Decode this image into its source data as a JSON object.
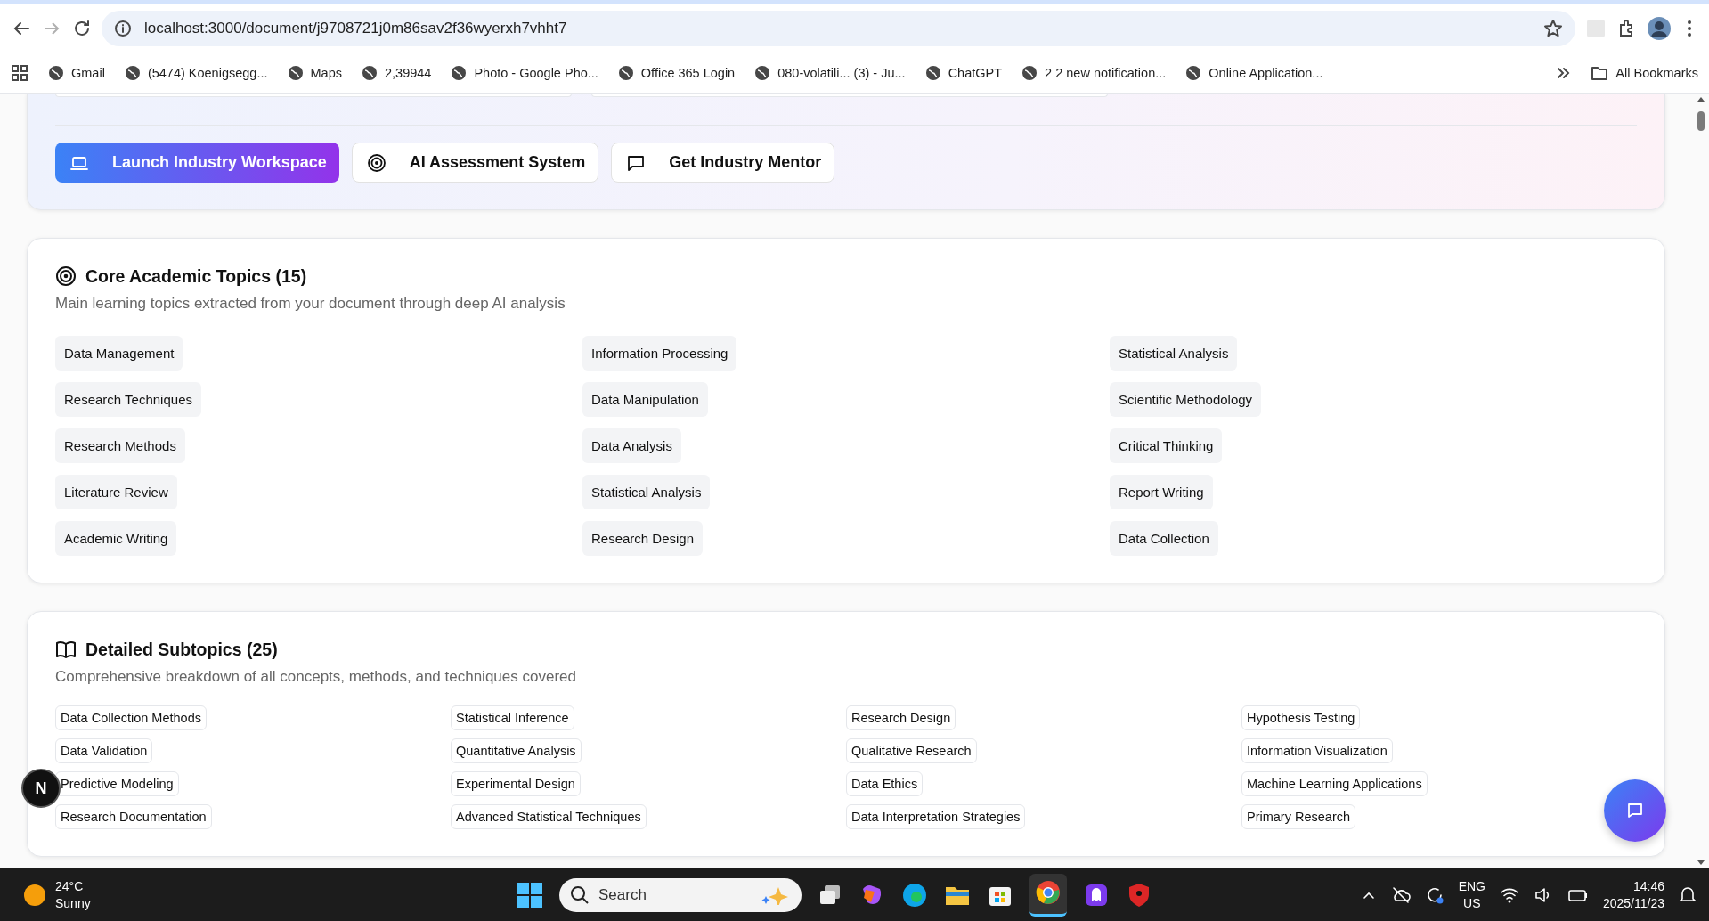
{
  "browser": {
    "url": "localhost:3000/document/j9708721j0m86sav2f36wyerxh7vhht7",
    "bookmarks": [
      "Gmail",
      "(5474) Koenigsegg...",
      "Maps",
      "2,39944",
      "Photo - Google Pho...",
      "Office 365 Login",
      "080-volatili... (3) - Ju...",
      "ChatGPT",
      "2 2 new notification...",
      "Online Application..."
    ],
    "all_bookmarks": "All Bookmarks"
  },
  "actions": [
    {
      "label": "Launch Industry Workspace",
      "kind": "primary"
    },
    {
      "label": "AI Assessment System",
      "kind": "outline"
    },
    {
      "label": "Get Industry Mentor",
      "kind": "outline"
    }
  ],
  "core_topics": {
    "title": "Core Academic Topics (15)",
    "subtitle": "Main learning topics extracted from your document through deep AI analysis",
    "topics": [
      "Data Management",
      "Information Processing",
      "Statistical Analysis",
      "Research Techniques",
      "Data Manipulation",
      "Scientific Methodology",
      "Research Methods",
      "Data Analysis",
      "Critical Thinking",
      "Literature Review",
      "Statistical Analysis",
      "Report Writing",
      "Academic Writing",
      "Research Design",
      "Data Collection"
    ]
  },
  "subtopics": {
    "title": "Detailed Subtopics (25)",
    "subtitle": "Comprehensive breakdown of all concepts, methods, and techniques covered",
    "items": [
      "Data Collection Methods",
      "Statistical Inference",
      "Research Design",
      "Hypothesis Testing",
      "Data Validation",
      "Quantitative Analysis",
      "Qualitative Research",
      "Information Visualization",
      "Predictive Modeling",
      "Experimental Design",
      "Data Ethics",
      "Machine Learning Applications",
      "Research Documentation",
      "Advanced Statistical Techniques",
      "Data Interpretation Strategies",
      "Primary Research"
    ]
  },
  "dev_indicator": "N",
  "taskbar": {
    "temperature": "24°C",
    "condition": "Sunny",
    "search_placeholder": "Search",
    "language": "ENG",
    "region": "US",
    "time": "14:46",
    "date": "2025/11/23"
  }
}
